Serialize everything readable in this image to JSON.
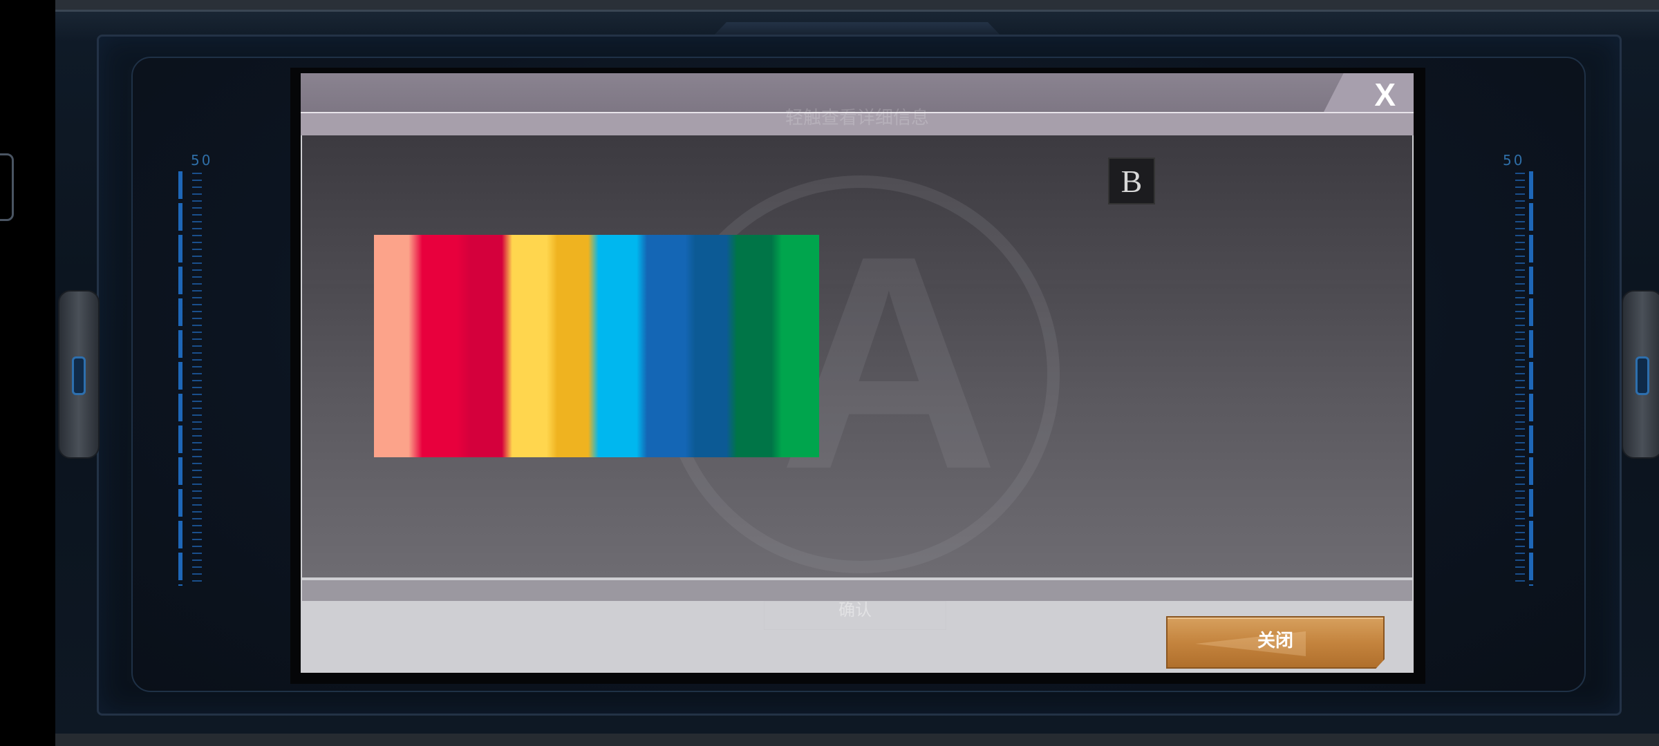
{
  "ruler_left": {
    "label": "50"
  },
  "ruler_right": {
    "label": "50"
  },
  "modal": {
    "ghost_title": "轻触查看详细信息",
    "close_x": "X",
    "badge": "B",
    "ghost_confirm": "确认",
    "close_button_label": "关闭"
  },
  "colors": {
    "stripes": [
      "#fca38a",
      "#e8003d",
      "#d4003c",
      "#ffd64e",
      "#efb320",
      "#00b7ef",
      "#1466b5",
      "#0c5a95",
      "#007547",
      "#00a54d"
    ],
    "button_accent": "#c4843e"
  }
}
